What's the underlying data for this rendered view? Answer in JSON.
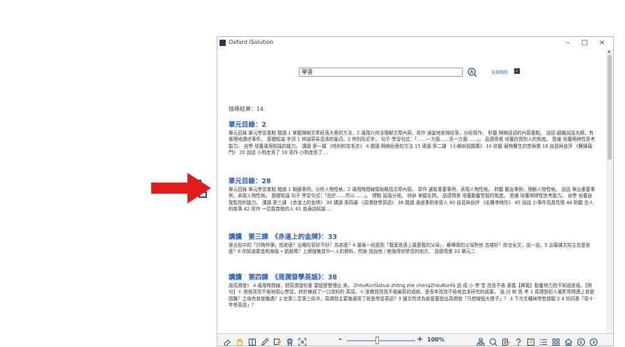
{
  "window": {
    "title": "Oxford iSolution",
    "minimize_glyph": "–",
    "maximize_glyph": "□",
    "close_glyph": "×"
  },
  "callout": {
    "help_glyph": "?",
    "icons": [
      "sitemap-icon",
      "search-icon",
      "notes-icon",
      "help-icon"
    ],
    "highlight_color": "#e21b1b",
    "arrow_color": "#e21b1b"
  },
  "search": {
    "query": "學習",
    "full_match_label": "全部相符",
    "full_match_checked": true
  },
  "results": {
    "count_label": "搜尋結果：14",
    "items": [
      {
        "title": "單元目錄：2",
        "snippet": "單元目錄 單元學習重點 閱讀 1 掌握歸納文章段落大意的方法，2 運用六何法理解文章內容。寫作 通當地安排段落，分段寫作。 聆聽 歸納話語的內容重點。 說話 組織說話大綱，有條理地講述事件。 基礎知識 字詞 1 辨識容易混淆的量詞。2 辨別形近字。 句子 學習句式：「……一方面……另一方面……」。 品德情意 培養欣賞別人的態度。 思維 培養明辨性思考能力。 自學 培養運用知識的能力。 講讀 第一課 《哈利的花毛衣》 4 閱讀 歸納段意的方法 15 導讀 第二課 《小蝌蚪找媽媽》 10 聆聽 寵物醫生的苦與樂 18 自習與自評 《鯉躍龍門》 20 說話 小狗走丟了 16 寫作 小狗走丟了 ..."
      },
      {
        "title": "單元目錄：28",
        "snippet": "單元目錄 單元學習重點 閱讀 1 根據事例，分析人物性格，2 運用時間線幫助概括文章內容。 寫作 選取重要事例，表現人物性格。 聆聽 聽出事例，理解人物性格。 說話 舉出重要事例，表現人物性格。 基礎知識 句子 學習句式：「由於……所以……」。 標點 認識分號。 修辭 掌握反問。 品德情意 培養勤奮堅毅的態度。 思維 培養明辨性思考能力。 自學 培養自我監控的能力。 講讀 第三課 《赤道上的金牌》 30 講讀 第四課 《周潤發學英語》 36 閱讀 通過事例來寫人 40 自習與自評 《名醫李時珍》 45 說話 小事件見真性情 44 聆聽 古人的故事 42 寫作 一位我尊敬的人 41 普通話知識 ..."
      },
      {
        "title": "講讀　第三課　《赤道上的金牌》：33",
        "snippet": "第五段中的「計時炸彈」指甚麼？這種形容好不好？為甚麼？4 最後一段提到「我家思遠上最愛我的父母」，蘇樺偉的父母對他 怎樣好？綜合全文，說一說，5 這篇課文的主旨是甚麼？6 你知道霍金和海倫 • 凱勒嗎？上網搜集其中一人的資料，然後 說說他 / 她值得你學習的地方。 品德情意 33 單元二"
      },
      {
        "title": "講讀　第四課　《周潤發學英語》：38",
        "snippet": "成周潤發》 4 運用時間線，把周潤發的重 要經歷整理出 來。 ZhōuRùnfāshuō zhōng zhè chéngZhōuRùnfā 語 成 小 學 堂 孜孜不倦 褒義【釋義】勤奮努力而不知道疲倦。【例句】① 爸爸孜孜不倦地用心學習，終於練成了一口流利的 英語。② 張教授孜孜不倦編寫的成就，是長年孜孜不倦地追求研究的成果。 論 討 和 思 考 1 周潤發初入電影界時遇上甚麼困難？之後有甚麼機遇？2 在第二至第三段中，周潤發主要做運用了甚麼學習英語？3 據文所述為甚麼要提出周潤發「只想做個大傻子」？ 3 下方文種與學堂經驗 2 4 你同意「周十年學英語」？"
      }
    ]
  },
  "toolbar": {
    "zoom_minus": "-",
    "zoom_plus": "+",
    "zoom_value": "100%",
    "zoom_fraction": 0.44,
    "left_icons": [
      "eraser-icon",
      "hand-icon",
      "rectangle-icon",
      "pen-icon",
      "highlighter-icon",
      "trash-icon",
      "fullscreen-icon"
    ],
    "right_icons": [
      "sitemap-icon",
      "search-icon",
      "notes-icon",
      "help-icon",
      "bookmark-icon",
      "list-icon",
      "grid-icon",
      "home-icon",
      "prev-page-icon",
      "next-page-icon"
    ],
    "icon_color": "#1f4e79",
    "accent_color": "#f2a01a"
  }
}
